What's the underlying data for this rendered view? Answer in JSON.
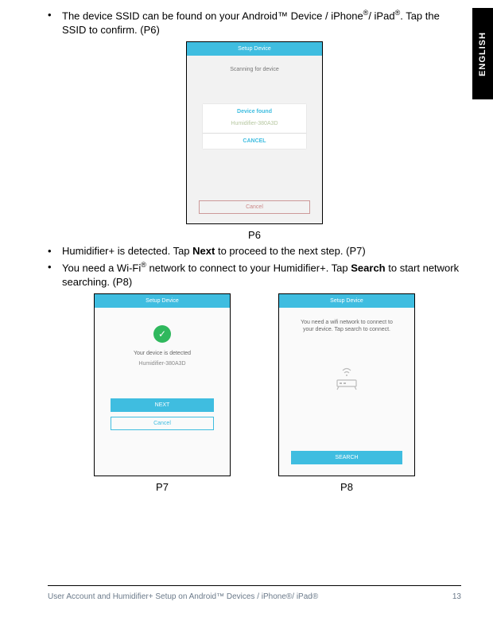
{
  "lang_tab": "ENGLISH",
  "bullets": {
    "b1_pre": "The device SSID can be found on your Android™ Device / iPhone",
    "b1_sup1": "®",
    "b1_mid": "/ iPad",
    "b1_sup2": "®",
    "b1_post": ". Tap the SSID to confirm. (P6)",
    "b2_pre": "Humidifier+ is detected. Tap ",
    "b2_bold": "Next",
    "b2_post": " to proceed to the next step. (P7)",
    "b3_pre": "You need a Wi-Fi",
    "b3_sup": "®",
    "b3_mid": " network to connect to your Humidifier+. Tap ",
    "b3_bold": "Search",
    "b3_post": " to start network searching. (P8)"
  },
  "p6": {
    "header": "Setup Device",
    "scanning": "Scanning for device",
    "found": "Device found",
    "ssid": "Humidifier-380A3D",
    "modal_cancel": "CANCEL",
    "bottom_cancel": "Cancel",
    "label": "P6"
  },
  "p7": {
    "header": "Setup Device",
    "detected": "Your device is detected",
    "ssid": "Humidifier-380A3D",
    "next": "NEXT",
    "cancel": "Cancel",
    "label": "P7"
  },
  "p8": {
    "header": "Setup Device",
    "msg": "You need a wifi network to connect to your device. Tap search to connect.",
    "search": "SEARCH",
    "label": "P8"
  },
  "footer": {
    "left": "User Account and Humidifier+ Setup on Android™ Devices / iPhone®/ iPad®",
    "right": "13"
  }
}
